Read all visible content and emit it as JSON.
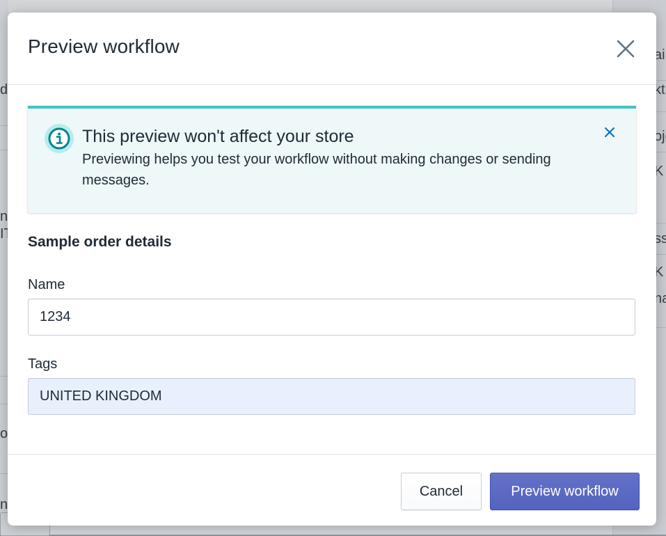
{
  "background": {
    "fragments": [
      "ai",
      "d",
      "kt",
      "oje",
      "K",
      "na",
      "IT",
      "ss",
      "K",
      "na",
      "ol",
      "n"
    ]
  },
  "modal": {
    "title": "Preview workflow",
    "close_icon": "close-icon",
    "banner": {
      "icon": "info-circle-icon",
      "title": "This preview won't affect your store",
      "text": "Previewing helps you test your workflow without making changes or sending messages.",
      "dismiss_icon": "close-icon",
      "accent_color": "#47c1bf",
      "background_color": "#eef8f9"
    },
    "section_title": "Sample order details",
    "fields": {
      "name_label": "Name",
      "name_value": "1234",
      "tags_label": "Tags",
      "tags_value": "UNITED KINGDOM"
    },
    "footer": {
      "cancel_label": "Cancel",
      "primary_label": "Preview workflow",
      "primary_color": "#5c6ac4"
    }
  }
}
